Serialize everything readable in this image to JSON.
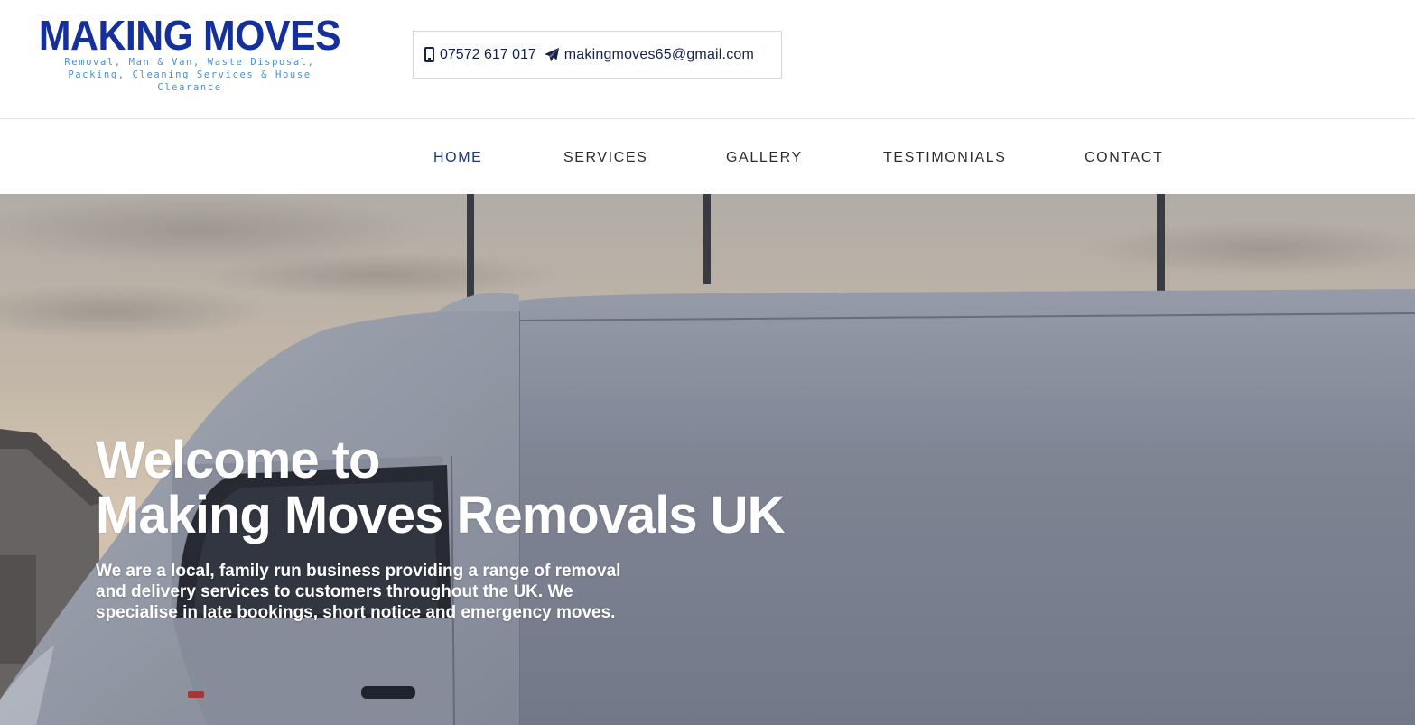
{
  "header": {
    "logo": {
      "title": "MAKING MOVES",
      "tagline": "Removal, Man & Van, Waste Disposal, Packing, Cleaning Services & House Clearance"
    },
    "contact": {
      "phone": "07572 617 017",
      "email": "makingmoves65@gmail.com",
      "phone_icon": "mobile-phone-icon",
      "email_icon": "paper-plane-icon"
    }
  },
  "nav": {
    "items": [
      {
        "label": "HOME",
        "active": true
      },
      {
        "label": "SERVICES"
      },
      {
        "label": "GALLERY"
      },
      {
        "label": "TESTIMONIALS"
      },
      {
        "label": "CONTACT"
      }
    ]
  },
  "hero": {
    "title_line1": "Welcome to",
    "title_line2": "Making Moves Removals UK",
    "text": "We are a local, family run business providing a range of removal and delivery services to customers throughout the UK. We specialise in late bookings, short notice and emergency moves."
  },
  "colors": {
    "brand": "#15309a",
    "tagline": "#4b8fcf",
    "nav_active": "#1c3580",
    "text_dark": "#14214d"
  }
}
